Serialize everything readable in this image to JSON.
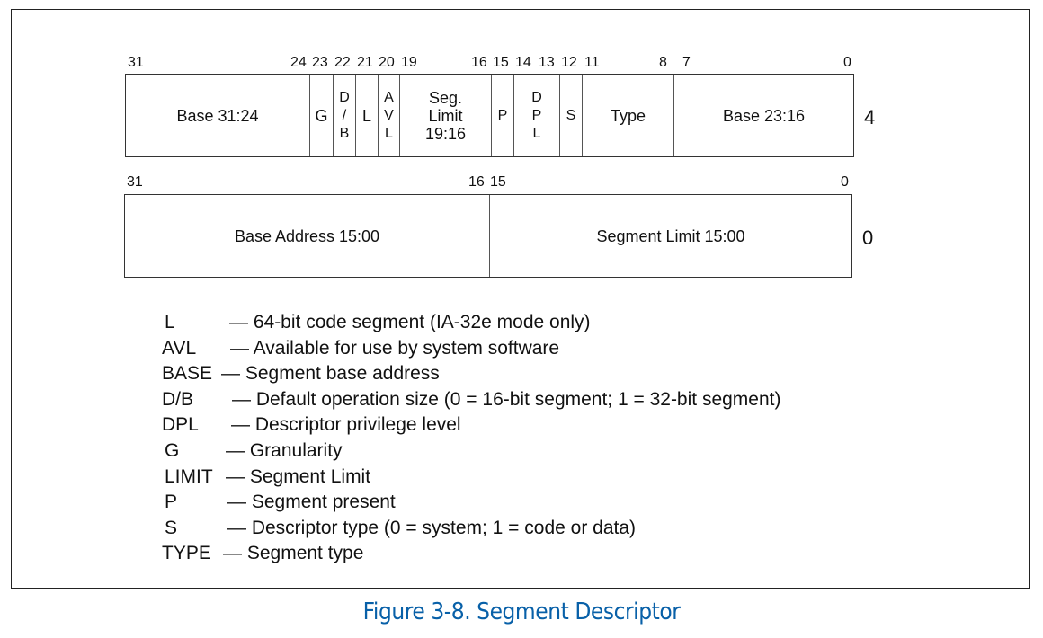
{
  "figure": {
    "caption": "Figure 3-8.  Segment Descriptor",
    "caption_color": "#0860a8"
  },
  "high_dword": {
    "offset_label": "4",
    "bit_numbers": [
      "31",
      "24",
      "23",
      "22",
      "21",
      "20",
      "19",
      "16",
      "15",
      "14",
      "13",
      "12",
      "11",
      "8",
      "7",
      "0"
    ],
    "fields": [
      {
        "id": "base-31-24",
        "label": "Base 31:24",
        "bits": "31:24"
      },
      {
        "id": "g",
        "label": "G",
        "bits": "23"
      },
      {
        "id": "d-b",
        "label": "D\n/\nB",
        "bits": "22"
      },
      {
        "id": "l",
        "label": "L",
        "bits": "21"
      },
      {
        "id": "avl",
        "label": "A\nV\nL",
        "bits": "20"
      },
      {
        "id": "seg-limit-19-16",
        "label": "Seg.\nLimit\n19:16",
        "bits": "19:16"
      },
      {
        "id": "p",
        "label": "P",
        "bits": "15"
      },
      {
        "id": "dpl",
        "label": "D\nP\nL",
        "bits": "14:13"
      },
      {
        "id": "s",
        "label": "S",
        "bits": "12"
      },
      {
        "id": "type",
        "label": "Type",
        "bits": "11:8"
      },
      {
        "id": "base-23-16",
        "label": "Base 23:16",
        "bits": "7:0"
      }
    ]
  },
  "low_dword": {
    "offset_label": "0",
    "bit_numbers": [
      "31",
      "16",
      "15",
      "0"
    ],
    "fields": [
      {
        "id": "base-address-15-00",
        "label": "Base Address 15:00",
        "bits": "31:16"
      },
      {
        "id": "segment-limit-15-00",
        "label": "Segment Limit 15:00",
        "bits": "15:0"
      }
    ]
  },
  "legend": [
    {
      "abbr": "L",
      "desc": "— 64-bit code segment (IA-32e mode only)"
    },
    {
      "abbr": "AVL",
      "desc": "— Available for use by system software"
    },
    {
      "abbr": "BASE",
      "desc": "— Segment base address"
    },
    {
      "abbr": "D/B",
      "desc": "— Default operation size (0 = 16-bit segment; 1 = 32-bit segment)"
    },
    {
      "abbr": "DPL",
      "desc": "— Descriptor privilege level"
    },
    {
      "abbr": "G",
      "desc": "— Granularity"
    },
    {
      "abbr": "LIMIT",
      "desc": "— Segment Limit"
    },
    {
      "abbr": "P",
      "desc": "— Segment present"
    },
    {
      "abbr": "S",
      "desc": "— Descriptor type (0 = system; 1 = code or data)"
    },
    {
      "abbr": "TYPE",
      "desc": "— Segment type"
    }
  ]
}
